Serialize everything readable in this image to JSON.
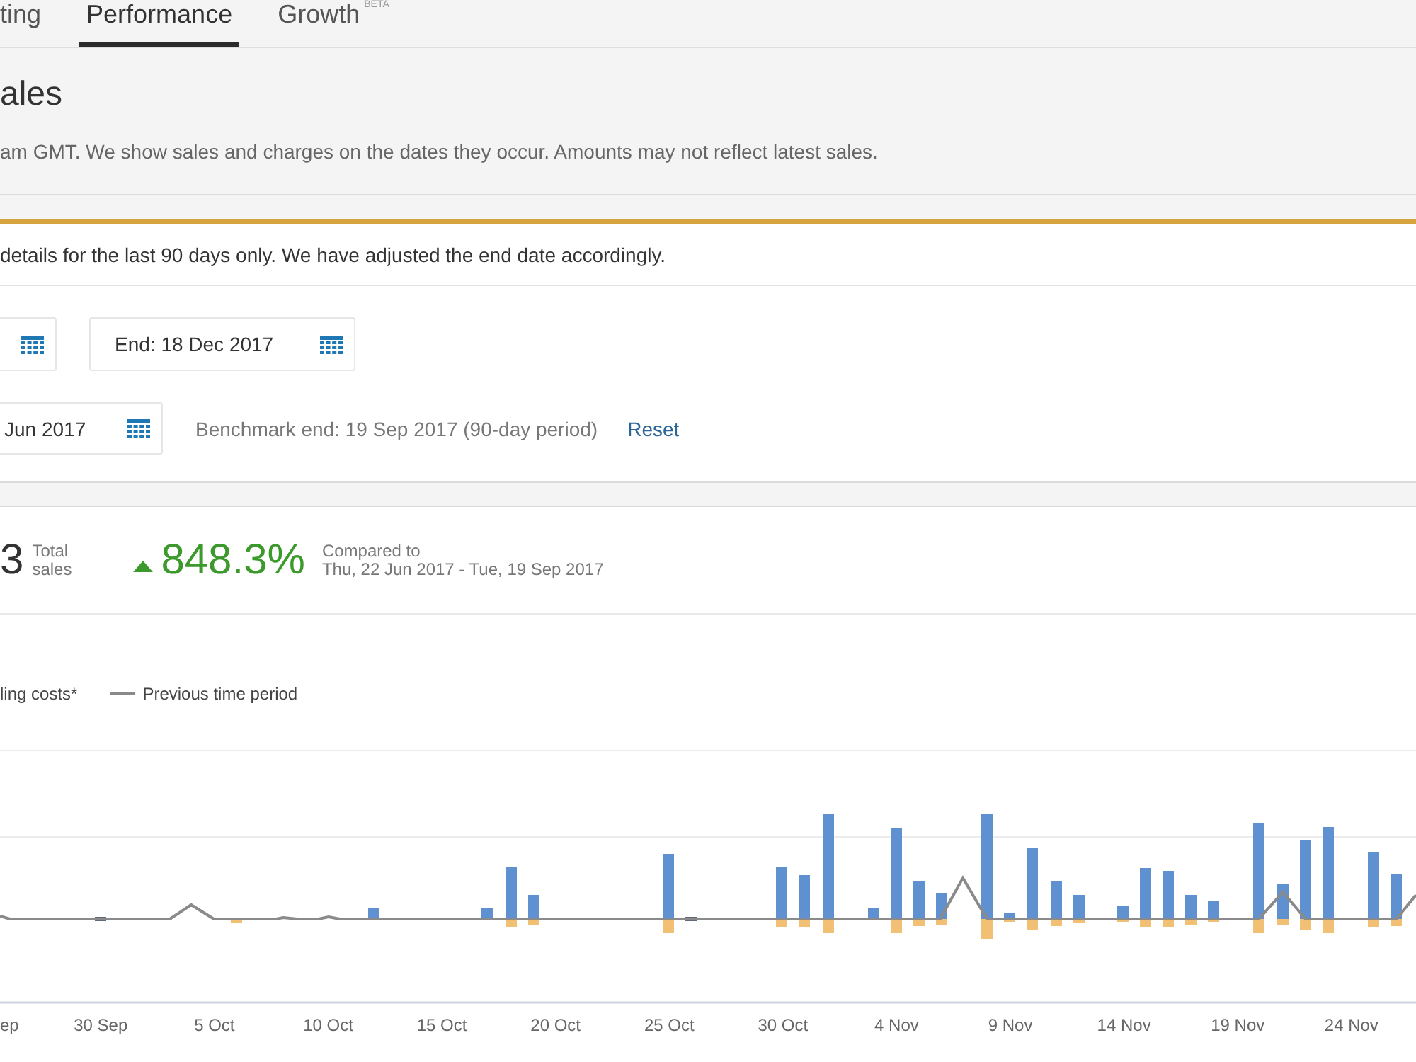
{
  "tabs": [
    {
      "label": "ting",
      "selected": false
    },
    {
      "label": "Performance",
      "selected": true
    },
    {
      "label": "Growth",
      "badge": "BETA",
      "selected": false
    }
  ],
  "page": {
    "title": "ales",
    "note": "am GMT. We show sales and charges on the dates they occur. Amounts may not reflect latest sales."
  },
  "alert": {
    "message": "details for the last 90 days only. We have adjusted the end date accordingly."
  },
  "date_range": {
    "end_value": "End: 18 Dec 2017"
  },
  "benchmark": {
    "start_value": "Jun 2017",
    "end_text": "Benchmark end: 19 Sep 2017 (90-day period)",
    "reset_link": "Reset"
  },
  "summary": {
    "total_value": "3",
    "total_label": "Total sales",
    "change": {
      "value": "848.3%",
      "increase": true
    },
    "comparison_label": "Compared to",
    "comparison_range": "Thu, 22 Jun 2017 - Tue, 19 Sep 2017"
  },
  "chart": {
    "legend": [
      {
        "label": "ling costs*",
        "kind": "label"
      },
      {
        "label": "Previous time period",
        "kind": "line"
      }
    ],
    "x_labels": [
      "ep",
      "30 Sep",
      "5 Oct",
      "10 Oct",
      "15 Oct",
      "20 Oct",
      "25 Oct",
      "30 Oct",
      "4 Nov",
      "9 Nov",
      "14 Nov",
      "19 Nov",
      "24 Nov"
    ]
  }
}
